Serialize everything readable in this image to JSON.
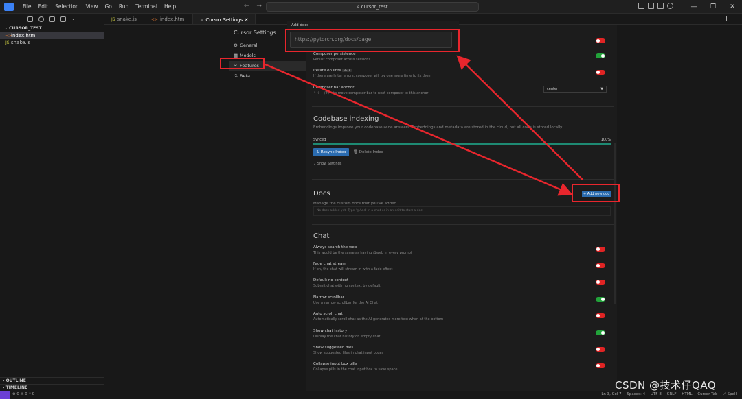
{
  "menu": [
    "File",
    "Edit",
    "Selection",
    "View",
    "Go",
    "Run",
    "Terminal",
    "Help"
  ],
  "search": "cursor_test",
  "explorer": {
    "folder": "CURSOR_TEST",
    "files": [
      {
        "name": "index.html",
        "type": "html"
      },
      {
        "name": "snake.js",
        "type": "js"
      }
    ],
    "outline": "OUTLINE",
    "timeline": "TIMELINE"
  },
  "tabs": [
    {
      "label": "snake.js",
      "type": "js"
    },
    {
      "label": "index.html",
      "type": "html"
    },
    {
      "label": "Cursor Settings",
      "type": "settings"
    }
  ],
  "settings": {
    "title": "Cursor Settings",
    "nav": [
      {
        "label": "General",
        "icon": "gear-icon"
      },
      {
        "label": "Models",
        "icon": "models-icon"
      },
      {
        "label": "Features",
        "icon": "tools-icon"
      },
      {
        "label": "Beta",
        "icon": "beta-icon"
      }
    ]
  },
  "popup": {
    "title": "Add docs",
    "placeholder": "https://pytorch.org/docs/page"
  },
  "top_rows": [
    {
      "label": "Composer persistence",
      "desc": "Persist composer across sessions",
      "on": true
    },
    {
      "label": "Iterate on lints",
      "beta": "BETA",
      "desc": "If there are linter errors, composer will try one more time to fix them",
      "on": false
    }
  ],
  "anchor": {
    "label": "Composer bar anchor",
    "desc": "⌃ ⇧ ←/↑/→ to move composer bar to next composer to this anchor",
    "value": "center"
  },
  "codebase": {
    "title": "Codebase indexing",
    "desc": "Embeddings improve your codebase-wide answers. Embeddings and metadata are stored in the cloud, but all code is stored locally.",
    "status": "Synced",
    "percent_label": "100%",
    "progress": 1.0,
    "resync": "↻ Resync Index",
    "delete": "🗑 Delete Index",
    "show": "⌄ Show Settings"
  },
  "docs": {
    "title": "Docs",
    "desc": "Manage the custom docs that you've added.",
    "add": "+ Add new doc",
    "empty": "No docs added yet. Type '@Add' in a chat or in an edit to start a doc."
  },
  "chat": {
    "title": "Chat",
    "rows": [
      {
        "label": "Always search the web",
        "desc": "This would be the same as having @web in every prompt",
        "on": false
      },
      {
        "label": "Fade chat stream",
        "desc": "If on, the chat will stream in with a fade effect",
        "on": false
      },
      {
        "label": "Default no context",
        "desc": "Submit chat with no context by default",
        "on": false
      },
      {
        "label": "Narrow scrollbar",
        "desc": "Use a narrow scrollbar for the AI Chat",
        "on": true
      },
      {
        "label": "Auto scroll chat",
        "desc": "Automatically scroll chat as the AI generates more text when at the bottom",
        "on": false
      },
      {
        "label": "Show chat history",
        "desc": "Display the chat history on empty chat",
        "on": true
      },
      {
        "label": "Show suggested files",
        "desc": "Show suggested files in chat input boxes",
        "on": false
      },
      {
        "label": "Collapse input box pills",
        "desc": "Collapse pills in the chat input box to save space",
        "on": false
      }
    ]
  },
  "status": {
    "left": "⊗ 0 ⚠ 0   ⑂ 0",
    "right": [
      "Ln 3, Col 7",
      "Spaces: 4",
      "UTF-8",
      "CRLF",
      "HTML",
      "Cursor Tab",
      "✓ Spell"
    ]
  },
  "watermark": "CSDN @技术仔QAQ",
  "colors": {
    "accent": "#2b6cb0",
    "toggle_on": "#22a33a",
    "toggle_off": "#e02424",
    "annotation": "#e8262d"
  }
}
